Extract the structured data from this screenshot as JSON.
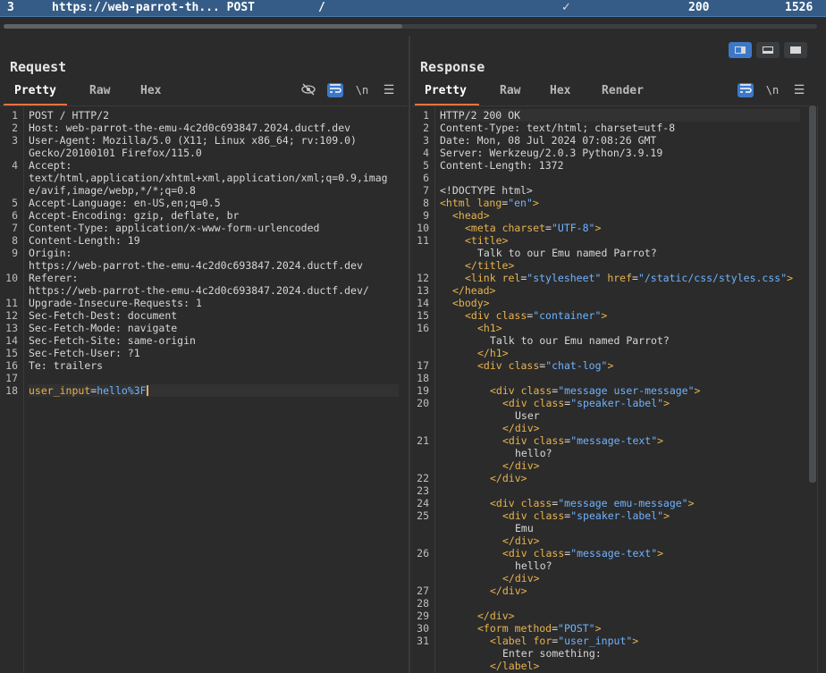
{
  "history": {
    "index": "3",
    "url": "https://web-parrot-th... POST",
    "path": "/",
    "check": "✓",
    "status": "200",
    "length": "1526"
  },
  "request": {
    "title": "Request",
    "tabs": [
      "Pretty",
      "Raw",
      "Hex"
    ],
    "icons": [
      "eye-slash-icon",
      "wrap-icon",
      "newline-icon",
      "menu-icon"
    ],
    "lines": [
      {
        "n": "1",
        "text": "POST / HTTP/2"
      },
      {
        "n": "2",
        "key": "Host",
        "val": " web-parrot-the-emu-4c2d0c693847.2024.ductf.dev"
      },
      {
        "n": "3",
        "key": "User-Agent",
        "val": " Mozilla/5.0 (X11; Linux x86_64; rv:109.0)"
      },
      {
        "n": "",
        "text": "Gecko/20100101 Firefox/115.0"
      },
      {
        "n": "4",
        "key": "Accept",
        "val": ""
      },
      {
        "n": "",
        "text": "text/html,application/xhtml+xml,application/xml;q=0.9,imag"
      },
      {
        "n": "",
        "text": "e/avif,image/webp,*/*;q=0.8"
      },
      {
        "n": "5",
        "key": "Accept-Language",
        "val": " en-US,en;q=0.5"
      },
      {
        "n": "6",
        "key": "Accept-Encoding",
        "val": " gzip, deflate, br"
      },
      {
        "n": "7",
        "key": "Content-Type",
        "val": " application/x-www-form-urlencoded"
      },
      {
        "n": "8",
        "key": "Content-Length",
        "val": " 19"
      },
      {
        "n": "9",
        "key": "Origin",
        "val": ""
      },
      {
        "n": "",
        "text": "https://web-parrot-the-emu-4c2d0c693847.2024.ductf.dev"
      },
      {
        "n": "10",
        "key": "Referer",
        "val": ""
      },
      {
        "n": "",
        "text": "https://web-parrot-the-emu-4c2d0c693847.2024.ductf.dev/"
      },
      {
        "n": "11",
        "key": "Upgrade-Insecure-Requests",
        "val": " 1"
      },
      {
        "n": "12",
        "key": "Sec-Fetch-Dest",
        "val": " document"
      },
      {
        "n": "13",
        "key": "Sec-Fetch-Mode",
        "val": " navigate"
      },
      {
        "n": "14",
        "key": "Sec-Fetch-Site",
        "val": " same-origin"
      },
      {
        "n": "15",
        "key": "Sec-Fetch-User",
        "val": " ?1"
      },
      {
        "n": "16",
        "key": "Te",
        "val": " trailers"
      },
      {
        "n": "17",
        "text": ""
      },
      {
        "n": "18",
        "param": "user_input",
        "pval": "hello%3F"
      }
    ]
  },
  "response": {
    "title": "Response",
    "tabs": [
      "Pretty",
      "Raw",
      "Hex",
      "Render"
    ],
    "icons": [
      "wrap-icon",
      "newline-icon",
      "menu-icon"
    ],
    "lines": [
      {
        "n": "1",
        "text": "HTTP/2 200 OK"
      },
      {
        "n": "2",
        "key": "Content-Type",
        "val": " text/html; charset=utf-8"
      },
      {
        "n": "3",
        "key": "Date",
        "val": " Mon, 08 Jul 2024 07:08:26 GMT"
      },
      {
        "n": "4",
        "key": "Server",
        "val": " Werkzeug/2.0.3 Python/3.9.19"
      },
      {
        "n": "5",
        "key": "Content-Length",
        "val": " 1372"
      },
      {
        "n": "6",
        "text": ""
      },
      {
        "n": "7",
        "text": "<!DOCTYPE html>"
      },
      {
        "n": "8",
        "html": "<tag>&lt;html</tag> <attr>lang</attr>=<str>\"en\"</str><tag>&gt;</tag>",
        "indent": 0
      },
      {
        "n": "9",
        "html": "<tag>&lt;head&gt;</tag>",
        "indent": 1
      },
      {
        "n": "10",
        "html": "<tag>&lt;meta</tag> <attr>charset</attr>=<str>\"UTF-8\"</str><tag>&gt;</tag>",
        "indent": 2
      },
      {
        "n": "11",
        "html": "<tag>&lt;title&gt;</tag>",
        "indent": 2
      },
      {
        "n": "",
        "text": "Talk to our Emu named Parrot?",
        "indent": 3
      },
      {
        "n": "",
        "html": "<tag>&lt;/title&gt;</tag>",
        "indent": 2
      },
      {
        "n": "12",
        "html": "<tag>&lt;link</tag> <attr>rel</attr>=<str>\"stylesheet\"</str> <attr>href</attr>=<str>\"/static/css/styles.css\"</str><tag>&gt;</tag>",
        "indent": 2
      },
      {
        "n": "13",
        "html": "<tag>&lt;/head&gt;</tag>",
        "indent": 1
      },
      {
        "n": "14",
        "html": "<tag>&lt;body&gt;</tag>",
        "indent": 1
      },
      {
        "n": "15",
        "html": "<tag>&lt;div</tag> <attr>class</attr>=<str>\"container\"</str><tag>&gt;</tag>",
        "indent": 2
      },
      {
        "n": "16",
        "html": "<tag>&lt;h1&gt;</tag>",
        "indent": 3
      },
      {
        "n": "",
        "text": "Talk to our Emu named Parrot?",
        "indent": 4
      },
      {
        "n": "",
        "html": "<tag>&lt;/h1&gt;</tag>",
        "indent": 3
      },
      {
        "n": "17",
        "html": "<tag>&lt;div</tag> <attr>class</attr>=<str>\"chat-log\"</str><tag>&gt;</tag>",
        "indent": 3
      },
      {
        "n": "18",
        "text": ""
      },
      {
        "n": "19",
        "html": "<tag>&lt;div</tag> <attr>class</attr>=<str>\"message user-message\"</str><tag>&gt;</tag>",
        "indent": 4
      },
      {
        "n": "20",
        "html": "<tag>&lt;div</tag> <attr>class</attr>=<str>\"speaker-label\"</str><tag>&gt;</tag>",
        "indent": 5
      },
      {
        "n": "",
        "text": "User",
        "indent": 6
      },
      {
        "n": "",
        "html": "<tag>&lt;/div&gt;</tag>",
        "indent": 5
      },
      {
        "n": "21",
        "html": "<tag>&lt;div</tag> <attr>class</attr>=<str>\"message-text\"</str><tag>&gt;</tag>",
        "indent": 5
      },
      {
        "n": "",
        "text": "hello?",
        "indent": 6
      },
      {
        "n": "",
        "html": "<tag>&lt;/div&gt;</tag>",
        "indent": 5
      },
      {
        "n": "22",
        "html": "<tag>&lt;/div&gt;</tag>",
        "indent": 4
      },
      {
        "n": "23",
        "text": ""
      },
      {
        "n": "24",
        "html": "<tag>&lt;div</tag> <attr>class</attr>=<str>\"message emu-message\"</str><tag>&gt;</tag>",
        "indent": 4
      },
      {
        "n": "25",
        "html": "<tag>&lt;div</tag> <attr>class</attr>=<str>\"speaker-label\"</str><tag>&gt;</tag>",
        "indent": 5
      },
      {
        "n": "",
        "text": "Emu",
        "indent": 6
      },
      {
        "n": "",
        "html": "<tag>&lt;/div&gt;</tag>",
        "indent": 5
      },
      {
        "n": "26",
        "html": "<tag>&lt;div</tag> <attr>class</attr>=<str>\"message-text\"</str><tag>&gt;</tag>",
        "indent": 5
      },
      {
        "n": "",
        "text": "hello?",
        "indent": 6
      },
      {
        "n": "",
        "html": "<tag>&lt;/div&gt;</tag>",
        "indent": 5
      },
      {
        "n": "27",
        "html": "<tag>&lt;/div&gt;</tag>",
        "indent": 4
      },
      {
        "n": "28",
        "text": ""
      },
      {
        "n": "29",
        "html": "<tag>&lt;/div&gt;</tag>",
        "indent": 3
      },
      {
        "n": "30",
        "html": "<tag>&lt;form</tag> <attr>method</attr>=<str>\"POST\"</str><tag>&gt;</tag>",
        "indent": 3
      },
      {
        "n": "31",
        "html": "<tag>&lt;label</tag> <attr>for</attr>=<str>\"user_input\"</str><tag>&gt;</tag>",
        "indent": 4
      },
      {
        "n": "",
        "text": "Enter something:",
        "indent": 5
      },
      {
        "n": "",
        "html": "<tag>&lt;/label&gt;</tag>",
        "indent": 4
      }
    ]
  },
  "view_toggle": [
    "split-horizontal-icon",
    "split-vertical-icon",
    "single-pane-icon"
  ]
}
